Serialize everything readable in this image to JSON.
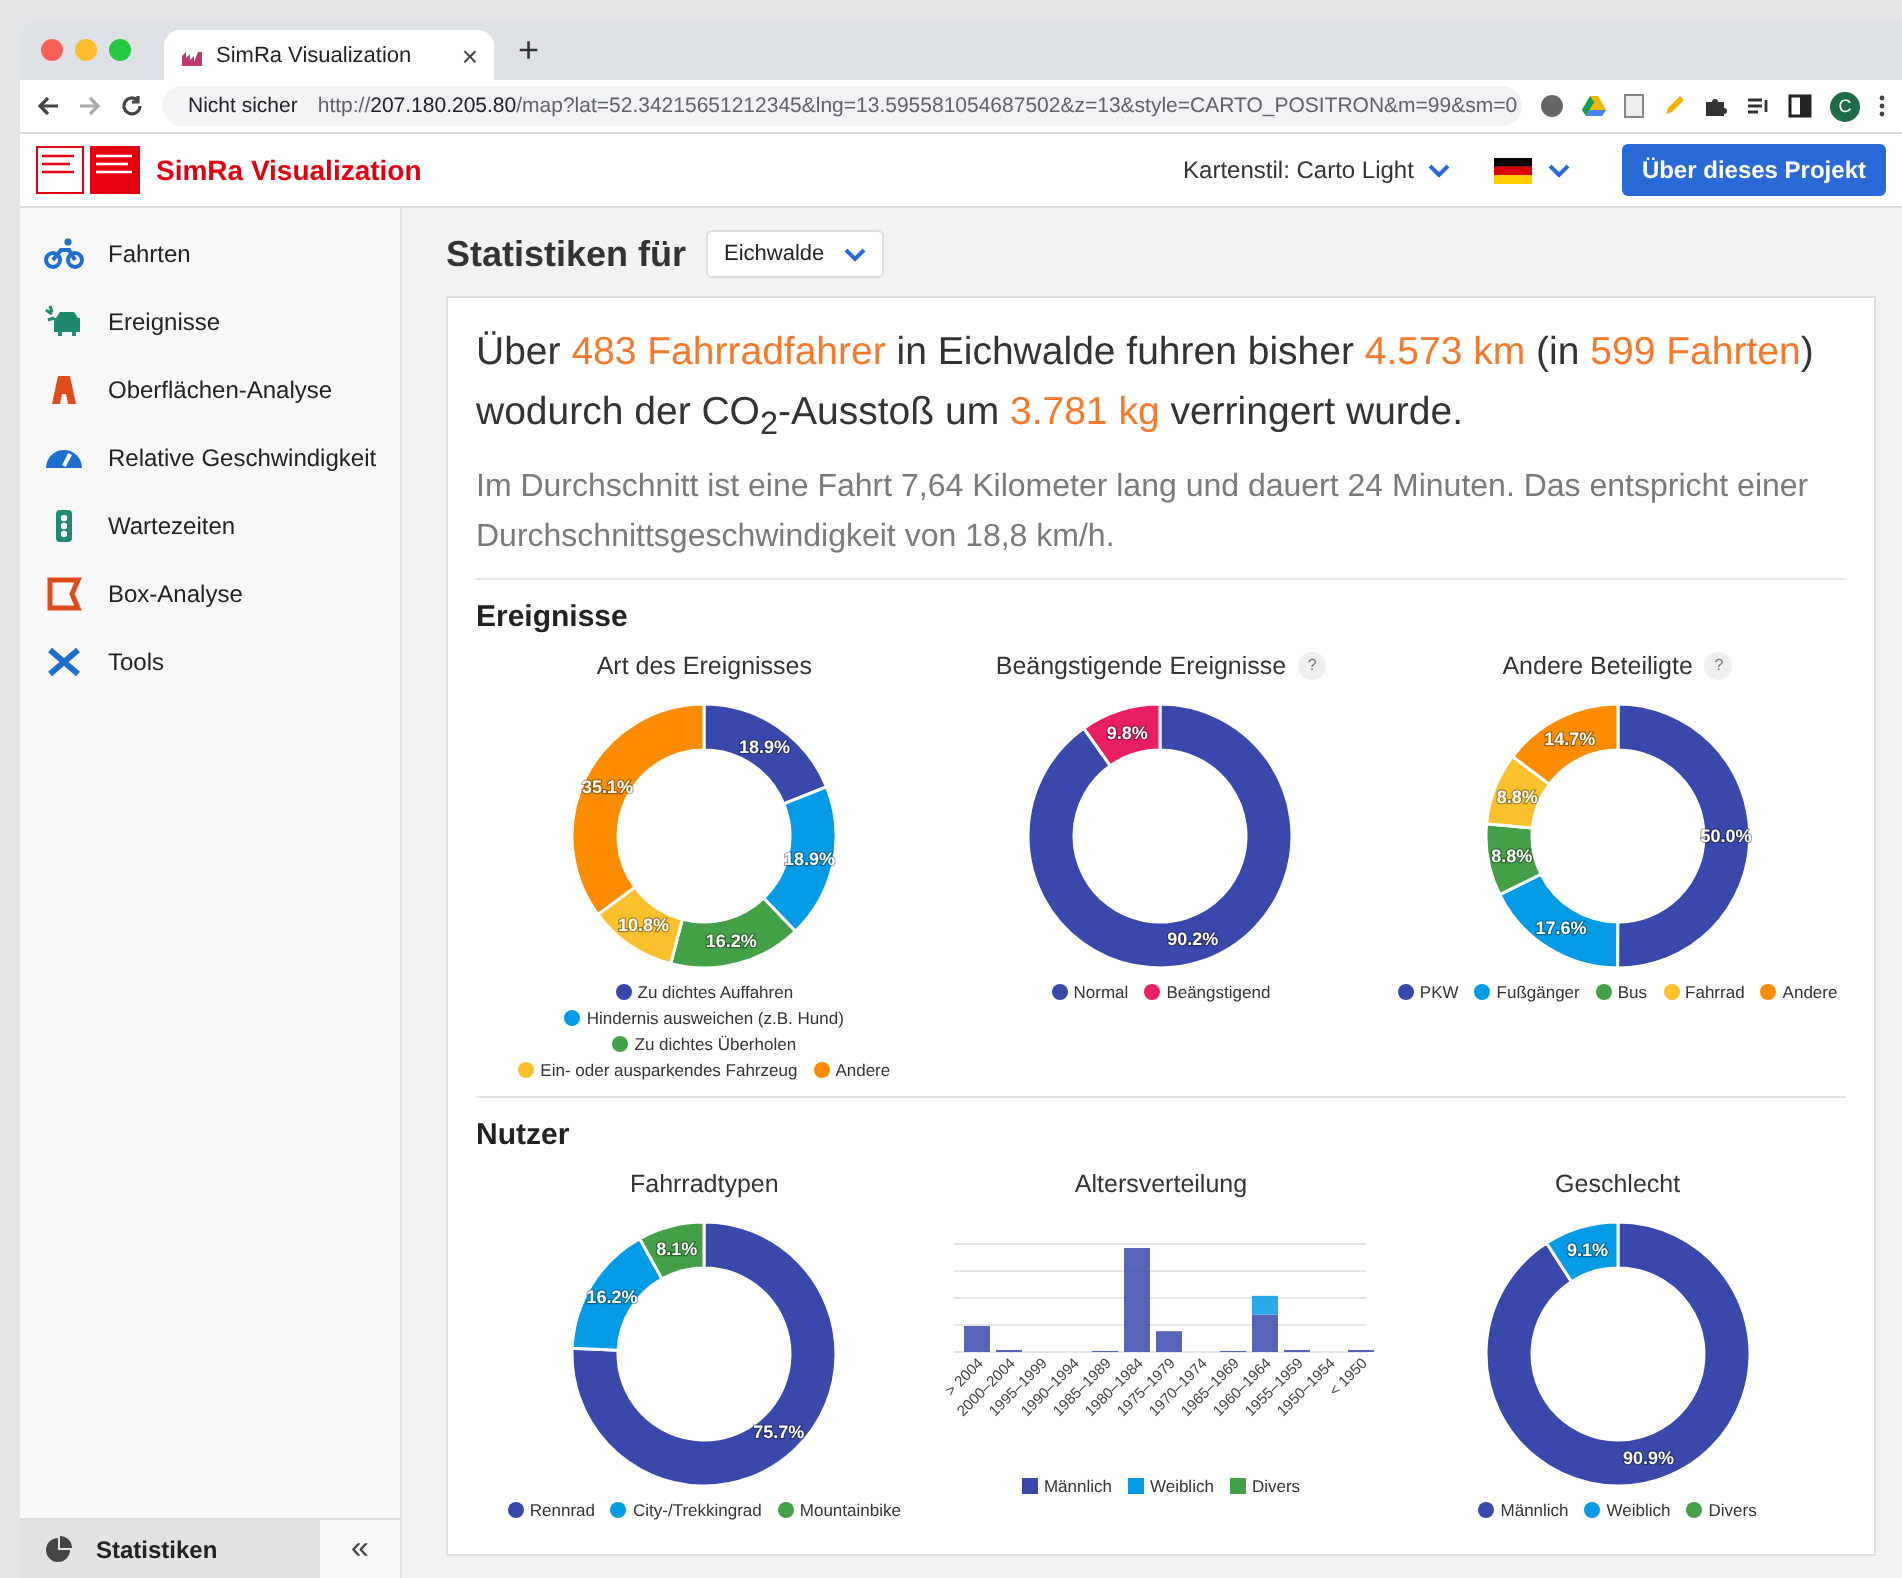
{
  "browser": {
    "tab_title": "SimRa Visualization",
    "tab_close": "×",
    "new_tab": "+",
    "security": "Nicht sicher",
    "url": "http://**207.180.205.80**/map?lat=52.34215651212345&lng=13.595581054687502&z=13&style=CARTO_POSITRON&m=99&sm=0",
    "avatar": "C"
  },
  "header": {
    "title": "SimRa Visualization",
    "map_style": "Kartenstil: Carto Light",
    "about_button": "Über dieses Projekt"
  },
  "sidebar": {
    "items": [
      {
        "label": "Fahrten",
        "selected": false
      },
      {
        "label": "Ereignisse",
        "selected": false
      },
      {
        "label": "Oberflächen-Analyse",
        "selected": false
      },
      {
        "label": "Relative Geschwindigkeit",
        "selected": false
      },
      {
        "label": "Wartezeiten",
        "selected": false
      },
      {
        "label": "Box-Analyse",
        "selected": false
      },
      {
        "label": "Tools",
        "selected": false
      }
    ],
    "footer": {
      "label": "Statistiken",
      "selected": true,
      "collapse": "«"
    }
  },
  "stats": {
    "heading": "Statistiken für",
    "region": "Eichwalde",
    "summary": [
      {
        "text": "Über ",
        "highlight": false
      },
      {
        "text": "483 Fahrradfahrer",
        "highlight": true
      },
      {
        "text": " in Eichwalde fuhren bisher ",
        "highlight": false
      },
      {
        "text": "4.573 km",
        "highlight": true
      },
      {
        "text": " (in ",
        "highlight": false
      },
      {
        "text": "599 Fahrten",
        "highlight": true
      },
      {
        "text": ") wodurch der CO$_{2}$-Ausstoß um ",
        "highlight": false
      },
      {
        "text": "3.781 kg",
        "highlight": true
      },
      {
        "text": " verringert wurde.",
        "highlight": false
      }
    ],
    "detail": "Im Durchschnitt ist eine Fahrt 7,64 Kilometer lang und dauert 24 Minuten. Das entspricht einer Durchschnittsgeschwindigkeit von 18,8 km/h."
  },
  "sections": [
    {
      "title": "Ereignisse",
      "charts": [
        {
          "kind": "donut",
          "chart_data": {
            "type": "donut",
            "title": "Art des Ereignisses",
            "categories": [
              "Zu dichtes Auffahren",
              "Hindernis ausweichen (z.B. Hund)",
              "Zu dichtes Überholen",
              "Ein- oder ausparkendes Fahrzeug",
              "Andere"
            ],
            "values": [
              18.9,
              18.9,
              16.2,
              10.8,
              35.1
            ],
            "colors": [
              "#3949ab",
              "#039be5",
              "#43a047",
              "#fbc02d",
              "#fb8c00"
            ],
            "value_labels": [
              "18.9%",
              "18.9%",
              "16.2%",
              "10.8%",
              "35.1%"
            ],
            "legend": "bottom"
          }
        },
        {
          "kind": "donut",
          "help": "?",
          "chart_data": {
            "type": "donut",
            "title": "Beängstigende Ereignisse",
            "categories": [
              "Normal",
              "Beängstigend"
            ],
            "values": [
              90.2,
              9.8
            ],
            "colors": [
              "#3949ab",
              "#e91e63"
            ],
            "value_labels": [
              "90.2%",
              "9.8%"
            ],
            "legend": "bottom"
          }
        },
        {
          "kind": "donut",
          "help": "?",
          "chart_data": {
            "type": "donut",
            "title": "Andere Beteiligte",
            "categories": [
              "PKW",
              "Fußgänger",
              "Bus",
              "Fahrrad",
              "Andere"
            ],
            "values": [
              50.0,
              17.6,
              8.8,
              8.8,
              14.7
            ],
            "colors": [
              "#3949ab",
              "#039be5",
              "#43a047",
              "#fbc02d",
              "#fb8c00"
            ],
            "value_labels": [
              "50.0%",
              "17.6%",
              "8.8%",
              "8.8%",
              "14.7%"
            ],
            "legend": "bottom"
          }
        }
      ]
    },
    {
      "title": "Nutzer",
      "charts": [
        {
          "kind": "donut",
          "chart_data": {
            "type": "donut",
            "title": "Fahrradtypen",
            "categories": [
              "Rennrad",
              "City-/Trekkingrad",
              "Mountainbike"
            ],
            "values": [
              75.7,
              16.2,
              8.1
            ],
            "colors": [
              "#3949ab",
              "#039be5",
              "#43a047"
            ],
            "value_labels": [
              "75.7%",
              "16.2%",
              "8.1%"
            ],
            "legend": "bottom"
          }
        },
        {
          "kind": "bars",
          "title": "Altersverteilung",
          "categories": [
            "> 2004",
            "2000–2004",
            "1995–1999",
            "1990–1994",
            "1985–1989",
            "1980–1984",
            "1975–1979",
            "1970–1974",
            "1965–1969",
            "1960–1964",
            "1955–1959",
            "1950–1954",
            "< 1950"
          ],
          "legend": [
            {
              "name": "Männlich",
              "color": "#3949ab"
            },
            {
              "name": "Weiblich",
              "color": "#039be5"
            },
            {
              "name": "Divers",
              "color": "#43a047"
            }
          ]
        },
        {
          "kind": "donut",
          "chart_data": {
            "type": "donut",
            "title": "Geschlecht",
            "categories": [
              "Männlich",
              "Weiblich",
              "Divers"
            ],
            "values": [
              90.9,
              9.1,
              0
            ],
            "colors": [
              "#3949ab",
              "#039be5",
              "#43a047"
            ],
            "value_labels": [
              "90.9%",
              "9.1%",
              null
            ],
            "legend": "bottom"
          }
        }
      ]
    }
  ]
}
